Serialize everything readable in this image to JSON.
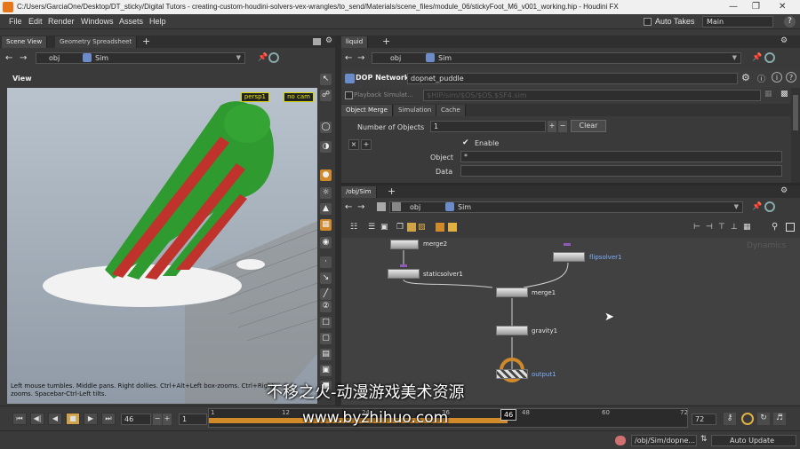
{
  "window": {
    "title": "C:/Users/GarciaOne/Desktop/DT_sticky/Digital Tutors - creating-custom-houdini-solvers-vex-wrangles/to_send/Materials/scene_files/module_06/stickyFoot_M6_v001_working.hip - Houdini FX",
    "minimize_icon": "minimize-icon",
    "maximize_icon": "maximize-icon",
    "close_icon": "close-icon"
  },
  "menu": {
    "items": [
      "File",
      "Edit",
      "Render",
      "Windows",
      "Assets",
      "Help"
    ],
    "auto_takes": "Auto Takes",
    "desktop": "Main"
  },
  "left_pane": {
    "tabs": [
      "Scene View",
      "Geometry Spreadsheet"
    ],
    "path": [
      "obj",
      "Sim"
    ],
    "view_label": "View",
    "camera": "persp1",
    "cam_menu": "no cam",
    "hint": "Left mouse tumbles. Middle pans. Right dollies. Ctrl+Alt+Left box-zooms. Ctrl+Right zooms. Spacebar-Ctrl-Left tilts."
  },
  "param_pane": {
    "tab": "liquid",
    "path": [
      "obj",
      "Sim"
    ],
    "type_label": "DOP Network",
    "node_name": "dopnet_puddle",
    "playback": "Playback Simulat...",
    "blurred_path": "$HIP/sim/$OS/$OS.$SF4.sim",
    "subtabs": [
      "Object Merge",
      "Simulation",
      "Cache"
    ],
    "num_objects_label": "Number of Objects",
    "num_objects_value": "1",
    "clear_label": "Clear",
    "enable_label": "Enable",
    "object_label": "Object",
    "object_value": "*",
    "data_label": "Data"
  },
  "network_pane": {
    "tab": "/obj/Sim",
    "path": [
      "obj",
      "Sim"
    ],
    "corner_label": "Dynamics",
    "nodes": [
      {
        "name": "merge2"
      },
      {
        "name": "flipsolver1"
      },
      {
        "name": "staticsolver1"
      },
      {
        "name": "merge1"
      },
      {
        "name": "gravity1"
      },
      {
        "name": "output1"
      }
    ]
  },
  "timeline": {
    "start_field": "46",
    "step_field": "1",
    "current_frame": "46",
    "ticks": [
      "1",
      "12",
      "24",
      "36",
      "48",
      "60",
      "72"
    ],
    "end_field": "72"
  },
  "status": {
    "path": "/obj/Sim/dopne...",
    "update_mode": "Auto Update"
  },
  "watermark": {
    "line1": "不移之火-动漫游戏美术资源",
    "line2": "www.byzhihuo.com"
  },
  "colors": {
    "accent": "#e8751a",
    "node_highlight": "#d08a2a",
    "geo_green": "#2f9a2f",
    "geo_red": "#c0322c"
  }
}
